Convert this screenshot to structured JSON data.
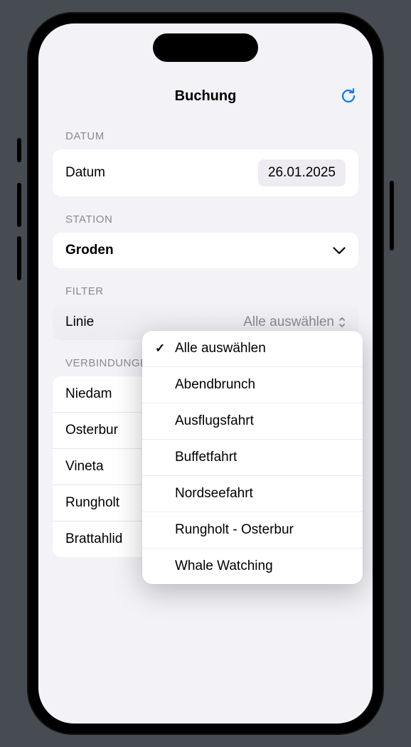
{
  "header": {
    "title": "Buchung"
  },
  "sections": {
    "datum": {
      "label": "DATUM",
      "field_label": "Datum",
      "value": "26.01.2025"
    },
    "station": {
      "label": "STATION",
      "value": "Groden"
    },
    "filter": {
      "label": "FILTER",
      "field_label": "Linie",
      "value": "Alle auswählen"
    },
    "verbindungen": {
      "label": "VERBINDUNGEN",
      "items": [
        "Niedam",
        "Osterbur",
        "Vineta",
        "Rungholt",
        "Brattahlid"
      ]
    }
  },
  "dropdown": {
    "options": [
      {
        "label": "Alle auswählen",
        "checked": true
      },
      {
        "label": "Abendbrunch",
        "checked": false
      },
      {
        "label": "Ausflugsfahrt",
        "checked": false
      },
      {
        "label": "Buffetfahrt",
        "checked": false
      },
      {
        "label": "Nordseefahrt",
        "checked": false
      },
      {
        "label": "Rungholt - Osterbur",
        "checked": false
      },
      {
        "label": "Whale Watching",
        "checked": false
      }
    ]
  }
}
